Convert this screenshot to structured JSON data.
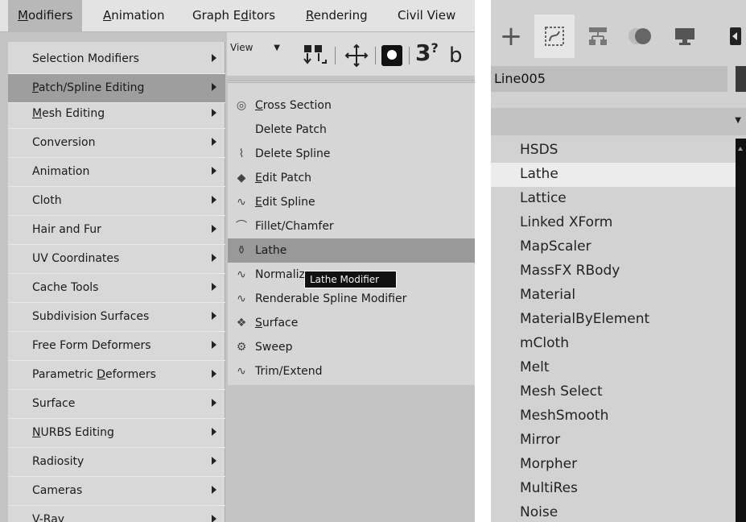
{
  "menubar": {
    "items": [
      {
        "label": "Modifiers",
        "ul": "M",
        "rest": "odifiers"
      },
      {
        "label": "Animation",
        "ul": "A",
        "rest": "nimation"
      },
      {
        "label": "Graph Editors",
        "pre": "Graph E",
        "ul": "d",
        "rest": "itors"
      },
      {
        "label": "Rendering",
        "ul": "R",
        "rest": "endering"
      },
      {
        "label": "Civil View"
      }
    ]
  },
  "toolbar": {
    "view_label": "View"
  },
  "modifiers_menu": {
    "items": [
      {
        "label": "Selection Modifiers"
      },
      {
        "label": "Patch/Spline Editing",
        "ul": "P",
        "rest": "atch/Spline Editing"
      },
      {
        "label": "Mesh Editing",
        "ul": "M",
        "rest": "esh Editing"
      },
      {
        "label": "Conversion"
      },
      {
        "label": "Animation"
      },
      {
        "label": "Cloth"
      },
      {
        "label": "Hair and Fur"
      },
      {
        "label": "UV Coordinates"
      },
      {
        "label": "Cache Tools"
      },
      {
        "label": "Subdivision Surfaces"
      },
      {
        "label": "Free Form Deformers"
      },
      {
        "label": "Parametric Deformers",
        "pre": "Parametric ",
        "ul": "D",
        "rest": "eformers"
      },
      {
        "label": "Surface"
      },
      {
        "label": "NURBS Editing",
        "ul": "N",
        "rest": "URBS Editing"
      },
      {
        "label": "Radiosity"
      },
      {
        "label": "Cameras"
      },
      {
        "label": "V-Ray"
      }
    ]
  },
  "submenu": {
    "items": [
      {
        "label": "Cross Section",
        "ul": "C",
        "rest": "ross Section",
        "icon": "cross-section-icon"
      },
      {
        "label": "Delete Patch",
        "icon": ""
      },
      {
        "label": "Delete Spline",
        "icon": "delete-spline-icon"
      },
      {
        "label": "Edit Patch",
        "ul": "E",
        "rest": "dit Patch",
        "icon": "edit-patch-icon"
      },
      {
        "label": "Edit Spline",
        "ul": "E",
        "rest": "dit Spline",
        "icon": "edit-spline-icon"
      },
      {
        "label": "Fillet/Chamfer",
        "icon": "fillet-chamfer-icon"
      },
      {
        "label": "Lathe",
        "icon": "lathe-icon"
      },
      {
        "label": "Normalize",
        "icon": "normalize-icon"
      },
      {
        "label": "Renderable Spline Modifier",
        "icon": "renderable-spline-icon"
      },
      {
        "label": "Surface",
        "ul": "S",
        "rest": "urface",
        "icon": "surface-icon"
      },
      {
        "label": "Sweep",
        "icon": "sweep-icon"
      },
      {
        "label": "Trim/Extend",
        "icon": "trim-extend-icon"
      }
    ]
  },
  "tooltip": {
    "text": "Lathe Modifier"
  },
  "command_panel": {
    "object_name": "Line005",
    "modifiers": [
      "HSDS",
      "Lathe",
      "Lattice",
      "Linked XForm",
      "MapScaler",
      "MassFX RBody",
      "Material",
      "MaterialByElement",
      "mCloth",
      "Melt",
      "Mesh Select",
      "MeshSmooth",
      "Mirror",
      "Morpher",
      "MultiRes",
      "Noise"
    ]
  }
}
